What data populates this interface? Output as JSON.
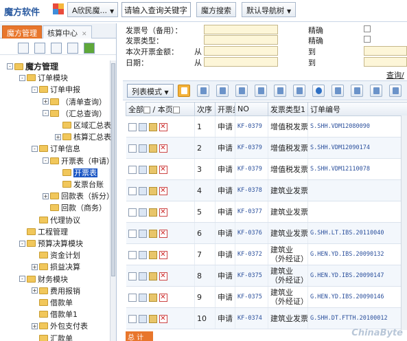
{
  "app": {
    "logo_text": "魔方软件"
  },
  "topbar": {
    "user_dropdown": "A欣民魔...",
    "search_placeholder": "请输入查询关键字",
    "search_button": "魔方搜索",
    "nav_tree_button": "默认导航树"
  },
  "left_tabs": [
    {
      "label": "魔方管理"
    },
    {
      "label": "核算中心"
    }
  ],
  "tree": [
    {
      "label": "魔方管理",
      "level": 0,
      "toggle": "-"
    },
    {
      "label": "订单模块",
      "level": 1,
      "toggle": "-"
    },
    {
      "label": "订单申报",
      "level": 2,
      "toggle": "-"
    },
    {
      "label": "（清单查询）",
      "level": 3,
      "toggle": "+"
    },
    {
      "label": "（汇总查询）",
      "level": 3,
      "toggle": "-"
    },
    {
      "label": "区域汇总表",
      "level": 4,
      "toggle": ""
    },
    {
      "label": "核算汇总表",
      "level": 4,
      "toggle": "+"
    },
    {
      "label": "订单信息",
      "level": 2,
      "toggle": "-"
    },
    {
      "label": "开票表（申请）",
      "level": 3,
      "toggle": "-"
    },
    {
      "label": "开票表",
      "level": 4,
      "toggle": "",
      "selected": true
    },
    {
      "label": "发票台账",
      "level": 4,
      "toggle": ""
    },
    {
      "label": "回款表（拆分）",
      "level": 3,
      "toggle": "+"
    },
    {
      "label": "回款（商务）",
      "level": 3,
      "toggle": ""
    },
    {
      "label": "代理协议",
      "level": 2,
      "toggle": ""
    },
    {
      "label": "工程管理",
      "level": 1,
      "toggle": ""
    },
    {
      "label": "预算决算模块",
      "level": 1,
      "toggle": "-"
    },
    {
      "label": "资金计划",
      "level": 2,
      "toggle": ""
    },
    {
      "label": "损益决算",
      "level": 2,
      "toggle": "+"
    },
    {
      "label": "财务模块",
      "level": 1,
      "toggle": "-"
    },
    {
      "label": "费用报销",
      "level": 2,
      "toggle": "+"
    },
    {
      "label": "借款单",
      "level": 2,
      "toggle": ""
    },
    {
      "label": "借款单1",
      "level": 2,
      "toggle": ""
    },
    {
      "label": "外包支付表",
      "level": 2,
      "toggle": "+"
    },
    {
      "label": "汇款单",
      "level": 2,
      "toggle": ""
    }
  ],
  "filter": {
    "invoice_no_label": "发票号（备用）：",
    "invoice_type_label": "发票类型：",
    "amount_label": "本次开票金额：",
    "date_label": "日期：",
    "from_label": "从",
    "to_label": "到",
    "exact_label": "精确",
    "query_button": "查询/"
  },
  "toolbar": {
    "list_mode": "列表模式"
  },
  "grid": {
    "headers": {
      "all": "全部",
      "page": "本页",
      "seq": "次序",
      "type": "开票类",
      "no": "NO",
      "invoice_type": "发票类型1",
      "order_no": "订单编号"
    },
    "rows": [
      {
        "seq": "1",
        "type": "申请",
        "no": "KF-0379",
        "invoice_type": "增值税发票",
        "order_no": "S.SHH.VDM12080090"
      },
      {
        "seq": "2",
        "type": "申请",
        "no": "KF-0379",
        "invoice_type": "增值税发票",
        "order_no": "S.SHH.VDM12090174"
      },
      {
        "seq": "3",
        "type": "申请",
        "no": "KF-0379",
        "invoice_type": "增值税发票",
        "order_no": "S.SHH.VDM12110078"
      },
      {
        "seq": "4",
        "type": "申请",
        "no": "KF-0378",
        "invoice_type": "建筑业发票",
        "order_no": ""
      },
      {
        "seq": "5",
        "type": "申请",
        "no": "KF-0377",
        "invoice_type": "建筑业发票",
        "order_no": ""
      },
      {
        "seq": "6",
        "type": "申请",
        "no": "KF-0376",
        "invoice_type": "建筑业发票",
        "order_no": "G.SHH.LT.IBS.20110040"
      },
      {
        "seq": "7",
        "type": "申请",
        "no": "KF-0372",
        "invoice_type": "建筑业（外经证）",
        "order_no": "G.HEN.YD.IBS.20090132"
      },
      {
        "seq": "8",
        "type": "申请",
        "no": "KF-0375",
        "invoice_type": "建筑业（外经证）",
        "order_no": "G.HEN.YD.IBS.20090147"
      },
      {
        "seq": "9",
        "type": "申请",
        "no": "KF-0375",
        "invoice_type": "建筑业（外经证）",
        "order_no": "G.HEN.YD.IBS.20090146"
      },
      {
        "seq": "10",
        "type": "申请",
        "no": "KF-0374",
        "invoice_type": "建筑业发票",
        "order_no": "G.SHH.DT.FTTH.20100012"
      }
    ],
    "total_label": "总 计"
  },
  "watermark": "ChinaByte"
}
